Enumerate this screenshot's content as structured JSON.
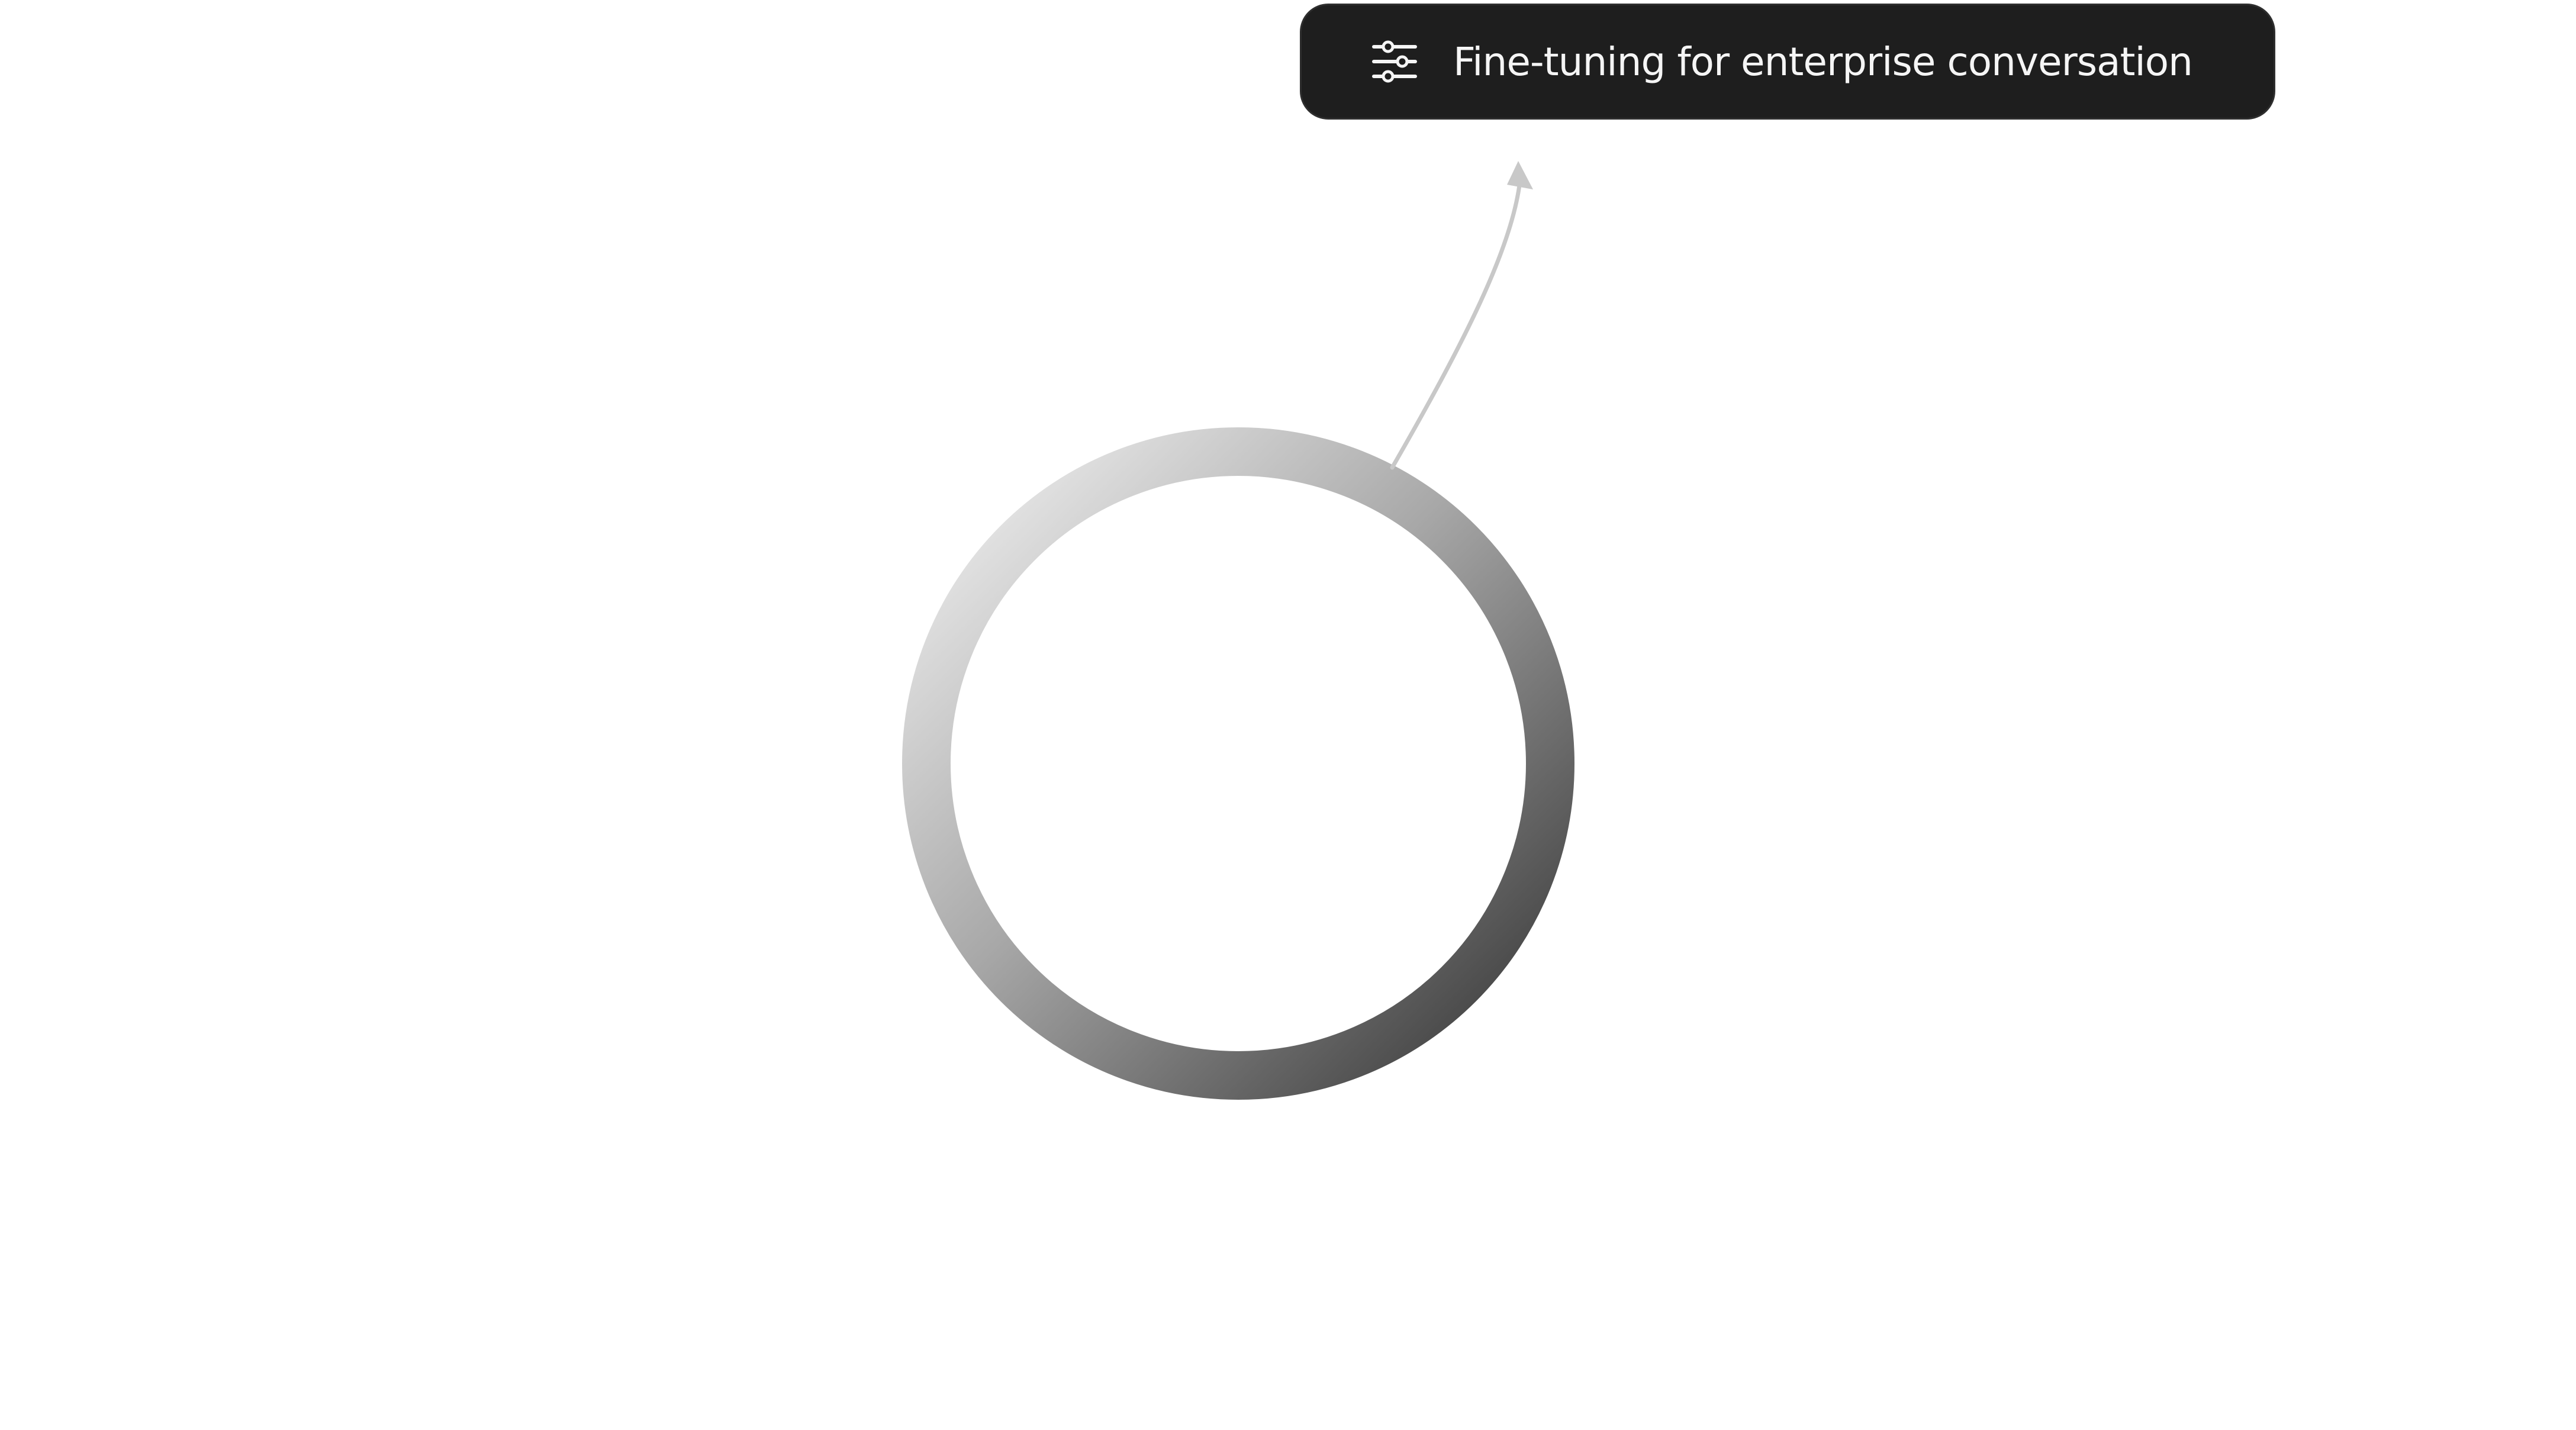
{
  "callout": {
    "label": "Fine-tuning for enterprise conversation",
    "icon": "sliders-icon",
    "background_color": "#1e1e1e",
    "text_color": "#f5f5f5"
  },
  "ring": {
    "gradient_start_color": "#f0f0f0",
    "gradient_end_color": "#404040"
  },
  "connector": {
    "color": "#c8c8c8",
    "style": "curved-arrow"
  }
}
